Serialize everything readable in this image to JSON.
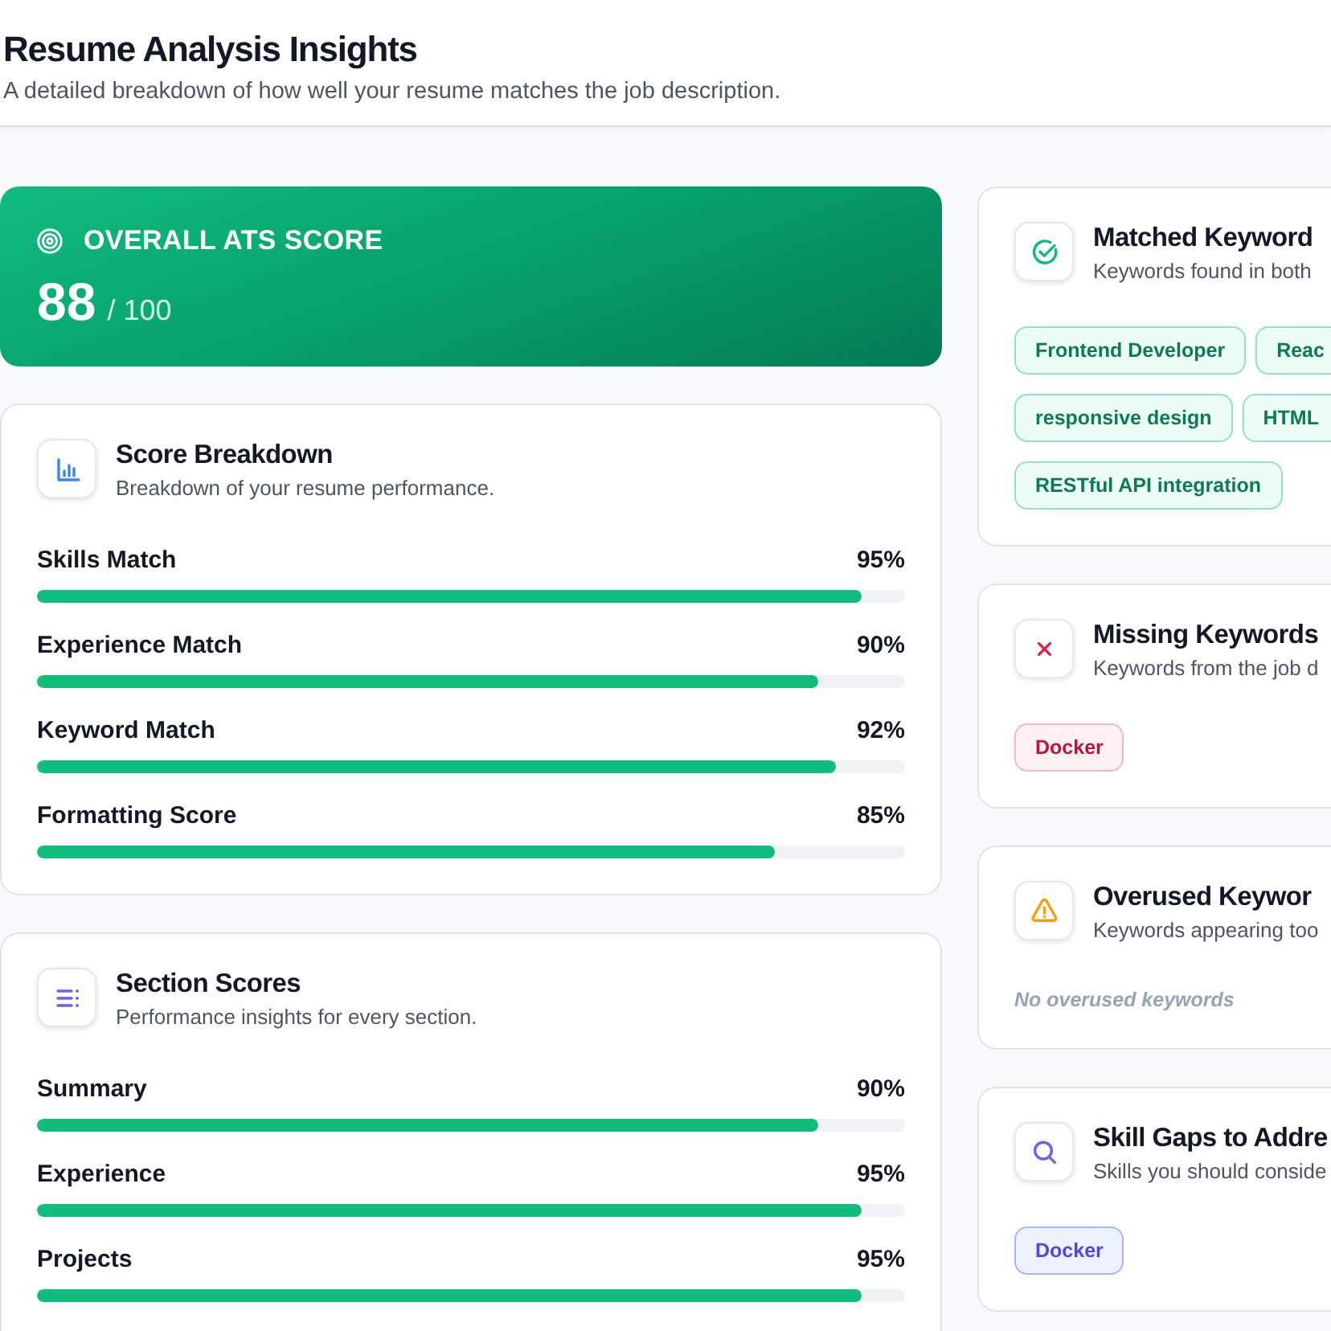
{
  "header": {
    "title": "Resume Analysis Insights",
    "subtitle": "A detailed breakdown of how well your resume matches the job description."
  },
  "overall": {
    "label": "OVERALL ATS SCORE",
    "score": "88",
    "max": "/ 100"
  },
  "score_cards": [
    {
      "kind": "breakdown",
      "title": "Score Breakdown",
      "subtitle": "Breakdown of your resume performance.",
      "metrics": [
        {
          "name": "Skills Match",
          "value": "95%",
          "level": 0.95
        },
        {
          "name": "Experience Match",
          "value": "90%",
          "level": 0.9
        },
        {
          "name": "Keyword Match",
          "value": "92%",
          "level": 0.92
        },
        {
          "name": "Formatting Score",
          "value": "85%",
          "level": 0.85
        }
      ]
    },
    {
      "kind": "sections",
      "title": "Section Scores",
      "subtitle": "Performance insights for every section.",
      "metrics": [
        {
          "name": "Summary",
          "value": "90%",
          "level": 0.9
        },
        {
          "name": "Experience",
          "value": "95%",
          "level": 0.95
        },
        {
          "name": "Projects",
          "value": "95%",
          "level": 0.95
        }
      ]
    }
  ],
  "keyword_cards": [
    {
      "kind": "matched",
      "title": "Matched Keyword",
      "subtitle": "Keywords found in both",
      "tags": [
        {
          "label": "Frontend Developer",
          "cut": false
        },
        {
          "label": "Reac",
          "cut": true
        },
        {
          "label": "responsive design",
          "cut": false
        },
        {
          "label": "HTML",
          "cut": true
        },
        {
          "label": "RESTful API integration",
          "cut": false
        }
      ]
    },
    {
      "kind": "missing",
      "title": "Missing Keywords",
      "subtitle": "Keywords from the job d",
      "tags": [
        {
          "label": "Docker",
          "cut": false
        }
      ]
    },
    {
      "kind": "overused",
      "title": "Overused Keywor",
      "subtitle": "Keywords appearing too",
      "empty_note": "No overused keywords"
    },
    {
      "kind": "gaps",
      "title": "Skill Gaps to Addre",
      "subtitle": "Skills you should conside",
      "tags": [
        {
          "label": "Docker",
          "cut": false
        }
      ]
    }
  ]
}
